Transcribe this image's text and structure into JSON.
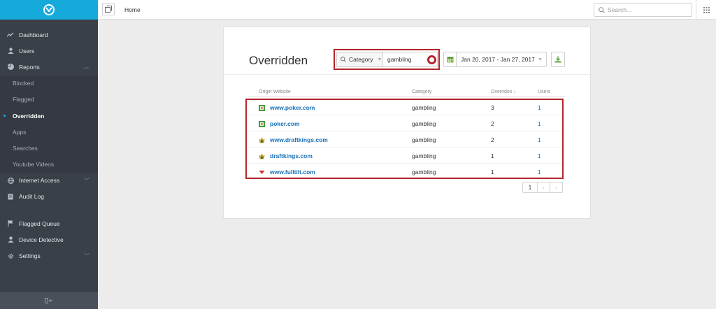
{
  "sidebar": {
    "items": [
      {
        "label": "Dashboard",
        "icon": "activity-icon"
      },
      {
        "label": "Users",
        "icon": "user-icon"
      },
      {
        "label": "Reports",
        "icon": "pie-chart-icon",
        "expanded": true,
        "children": [
          "Blocked",
          "Flagged",
          "Overridden",
          "Apps",
          "Searches",
          "Youtube Videos"
        ],
        "active_child": "Overridden"
      },
      {
        "label": "Internet Access",
        "icon": "globe-icon",
        "expandable": true
      },
      {
        "label": "Audit Log",
        "icon": "document-icon"
      },
      {
        "label": "Flagged Queue",
        "icon": "flag-icon"
      },
      {
        "label": "Device Detective",
        "icon": "user-icon"
      },
      {
        "label": "Settings",
        "icon": "gear-icon",
        "expandable": true
      }
    ]
  },
  "header": {
    "breadcrumb": "Home",
    "search_placeholder": "Search..."
  },
  "main": {
    "title": "Overridden",
    "filter": {
      "field": "Category",
      "value": "gambling"
    },
    "date_range": "Jan 20, 2017 - Jan 27, 2017",
    "table": {
      "columns": [
        "Origin Website",
        "Category",
        "Overrides",
        "Users"
      ],
      "sort_column": "Overrides",
      "rows": [
        {
          "site": "www.poker.com",
          "category": "gambling",
          "overrides": "3",
          "users": "1",
          "favicon": "poker-favicon-icon"
        },
        {
          "site": "poker.com",
          "category": "gambling",
          "overrides": "2",
          "users": "1",
          "favicon": "poker-favicon-icon"
        },
        {
          "site": "www.draftkings.com",
          "category": "gambling",
          "overrides": "2",
          "users": "1",
          "favicon": "draftkings-favicon-icon"
        },
        {
          "site": "draftkings.com",
          "category": "gambling",
          "overrides": "1",
          "users": "1",
          "favicon": "draftkings-favicon-icon"
        },
        {
          "site": "www.fulltilt.com",
          "category": "gambling",
          "overrides": "1",
          "users": "1",
          "favicon": "fulltilt-favicon-icon"
        }
      ]
    },
    "pagination": {
      "current_page": "1",
      "prev": "‹",
      "next": "›"
    }
  },
  "colors": {
    "brand": "#16a9dc",
    "sidebar_bg": "#3a4048",
    "link": "#1b72b8",
    "highlight": "#b3262c"
  }
}
